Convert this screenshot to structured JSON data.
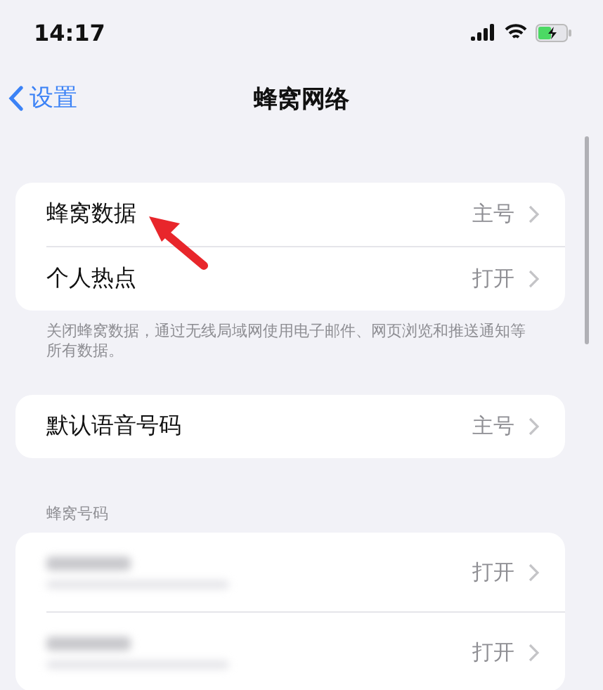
{
  "status_bar": {
    "time": "14:17"
  },
  "nav": {
    "back": "设置",
    "title": "蜂窝网络"
  },
  "groups": [
    {
      "rows": [
        {
          "label": "蜂窝数据",
          "value": "主号"
        },
        {
          "label": "个人热点",
          "value": "打开"
        }
      ],
      "footer": "关闭蜂窝数据，通过无线局域网使用电子邮件、网页浏览和推送通知等所有数据。"
    },
    {
      "rows": [
        {
          "label": "默认语音号码",
          "value": "主号"
        }
      ]
    },
    {
      "header": "蜂窝号码",
      "rows": [
        {
          "redacted": true,
          "value": "打开"
        },
        {
          "redacted": true,
          "value": "打开"
        }
      ]
    }
  ]
}
